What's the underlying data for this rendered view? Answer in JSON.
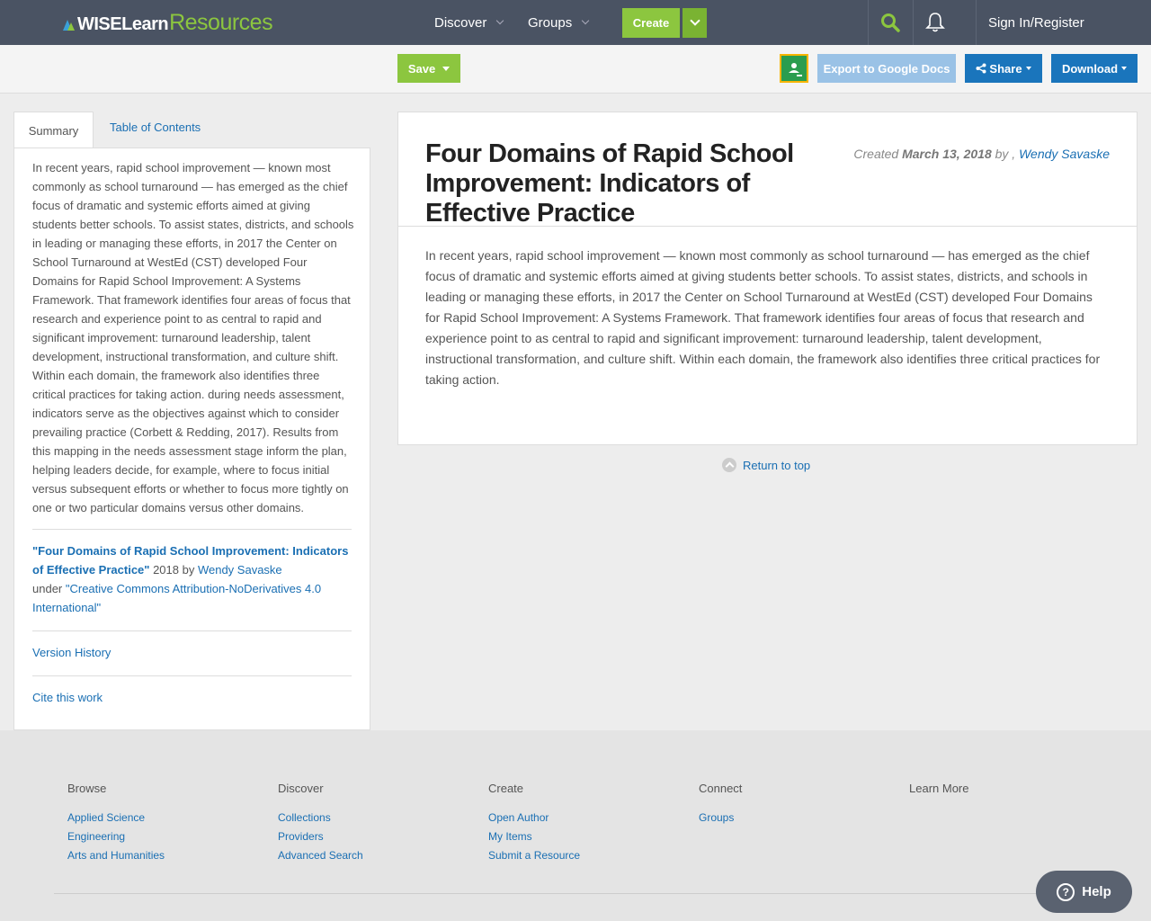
{
  "header": {
    "logo_wise": "WISELearn",
    "logo_resources": "Resources",
    "nav": [
      {
        "label": "Discover"
      },
      {
        "label": "Groups"
      }
    ],
    "create_label": "Create",
    "signin_label": "Sign In/Register"
  },
  "toolbar": {
    "save_label": "Save",
    "export_label": "Export to Google Docs",
    "share_label": "Share",
    "download_label": "Download"
  },
  "sidebar": {
    "tabs": [
      {
        "label": "Summary",
        "active": true
      },
      {
        "label": "Table of Contents",
        "active": false
      }
    ],
    "summary": "In recent years, rapid school improvement — known most commonly as school turnaround — has emerged as the chief focus of dramatic and systemic efforts aimed at giving students better schools. To assist states, districts, and schools in leading or managing these efforts, in 2017 the Center on School Turnaround at WestEd (CST) developed Four Domains for Rapid School Improvement: A Systems Framework. That framework identifies four areas of focus that research and experience point to as central to rapid and significant improvement: turnaround leadership, talent development, instructional transformation, and culture shift. Within each domain, the framework also identifies three critical practices for taking action. during needs assessment, indicators serve as the objectives against which to consider prevailing practice (Corbett & Redding, 2017). Results from this mapping in the needs assessment stage inform the plan, helping leaders decide, for example, where to focus initial versus subsequent efforts or whether to focus more tightly on one or two particular domains versus other domains.",
    "attribution": {
      "title": "\"Four Domains of Rapid School Improvement: Indicators of Effective Practice\"",
      "year_by": " 2018 by ",
      "author": "Wendy Savaske",
      "under": "under ",
      "license": "\"Creative Commons Attribution-NoDerivatives 4.0 International\""
    },
    "version_history": "Version History",
    "cite": "Cite this work"
  },
  "main": {
    "title": "Four Domains of Rapid School Improvement: Indicators of Effective Practice",
    "created_label": "Created ",
    "created_date": "March 13, 2018",
    "by_label": " by , ",
    "author": "Wendy Savaske",
    "body": "In recent years, rapid school improvement — known most commonly as school turnaround — has emerged as the chief focus of dramatic and systemic efforts aimed at giving students better schools. To assist states, districts, and schools in leading or managing these efforts, in 2017 the Center on School Turnaround at WestEd (CST) developed Four Domains for Rapid School Improvement: A Systems Framework. That framework identifies four areas of focus that research and experience point to as central to rapid and significant improvement:  turnaround leadership, talent development, instructional transformation, and culture shift. Within each domain, the framework also identifies three critical practices for taking action.",
    "return_top": "Return to top"
  },
  "footer": {
    "columns": [
      {
        "heading": "Browse",
        "links": [
          "Applied Science",
          "Engineering",
          "Arts and Humanities"
        ]
      },
      {
        "heading": "Discover",
        "links": [
          "Collections",
          "Providers",
          "Advanced Search"
        ]
      },
      {
        "heading": "Create",
        "links": [
          "Open Author",
          "My Items",
          "Submit a Resource"
        ]
      },
      {
        "heading": "Connect",
        "links": [
          "Groups"
        ]
      },
      {
        "heading": "Learn More",
        "links": []
      }
    ],
    "help_label": "Help"
  },
  "colors": {
    "nav_bg": "#4a5363",
    "green": "#8cc63f",
    "blue": "#1a75bc",
    "link": "#1a6fb3"
  }
}
